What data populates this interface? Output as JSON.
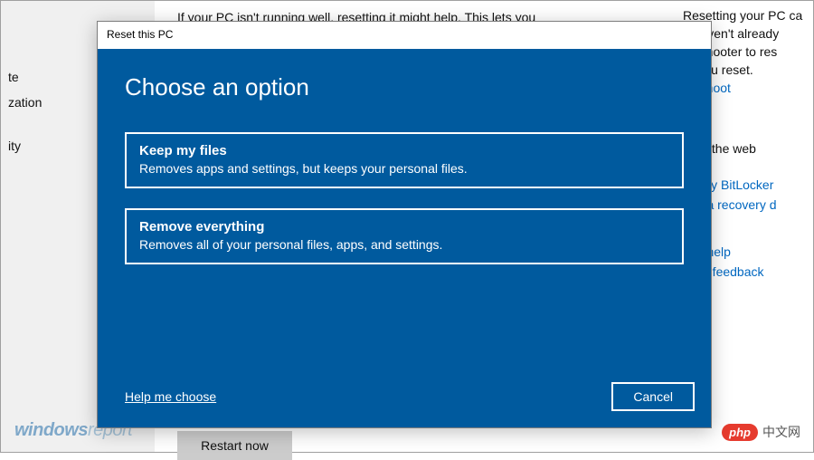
{
  "background": {
    "sidebar_items": [
      "te",
      "zation",
      "ity"
    ],
    "top_text": "If your PC isn't running well, resetting it might help. This lets you",
    "right_lines": [
      "Resetting your PC ca",
      "u haven't already",
      "bleshooter to res",
      "re you reset."
    ],
    "troubleshoot_link": "bleshoot",
    "from_web": "from the web",
    "bitlocker_link": "ng my BitLocker",
    "recovery_link": "ting a recovery d",
    "get_help_link": "Get help",
    "feedback_link": "Give feedback",
    "restart_btn": "Restart now"
  },
  "watermark": {
    "left_part1": "windows",
    "left_part2": "report",
    "right_badge": "php",
    "right_text": "中文网"
  },
  "dialog": {
    "title": "Reset this PC",
    "heading": "Choose an option",
    "options": [
      {
        "title": "Keep my files",
        "desc": "Removes apps and settings, but keeps your personal files."
      },
      {
        "title": "Remove everything",
        "desc": "Removes all of your personal files, apps, and settings."
      }
    ],
    "help_link": "Help me choose",
    "cancel": "Cancel"
  }
}
